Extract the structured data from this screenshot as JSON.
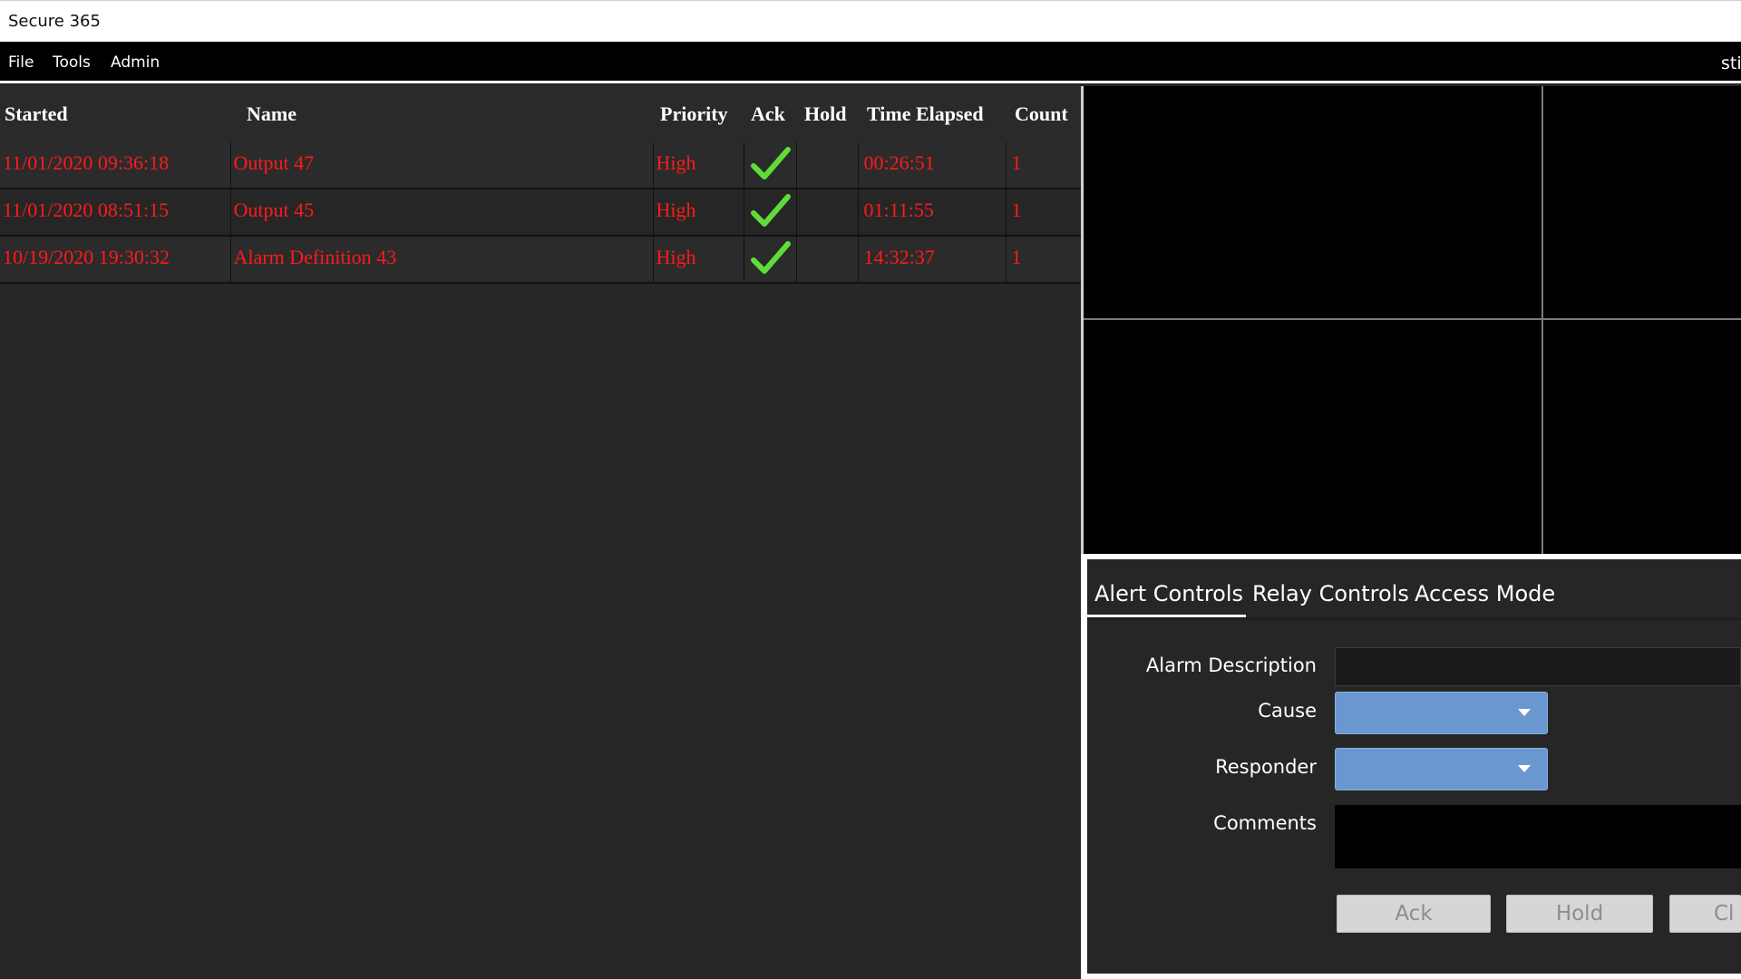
{
  "window": {
    "title": "Secure 365"
  },
  "menu": {
    "items": [
      {
        "label": "File"
      },
      {
        "label": "Tools"
      },
      {
        "label": "Admin"
      }
    ],
    "user_label": "sti"
  },
  "alarms": {
    "columns": [
      "Started",
      "Name",
      "Priority",
      "Ack",
      "Hold",
      "Time Elapsed",
      "Count"
    ],
    "rows": [
      {
        "started": "11/01/2020 09:36:18",
        "name": "Output 47",
        "priority": "High",
        "ack": true,
        "hold": "",
        "elapsed": "00:26:51",
        "count": "1"
      },
      {
        "started": "11/01/2020 08:51:15",
        "name": "Output 45",
        "priority": "High",
        "ack": true,
        "hold": "",
        "elapsed": "01:11:55",
        "count": "1"
      },
      {
        "started": "10/19/2020 19:30:32",
        "name": "Alarm Definition 43",
        "priority": "High",
        "ack": true,
        "hold": "",
        "elapsed": "14:32:37",
        "count": "1"
      }
    ]
  },
  "controls": {
    "tabs": [
      {
        "label": "Alert Controls",
        "active": true
      },
      {
        "label": "Relay Controls",
        "active": false
      },
      {
        "label": "Access Mode",
        "active": false
      }
    ],
    "fields": {
      "description_label": "Alarm Description",
      "description_value": "",
      "cause_label": "Cause",
      "cause_value": "",
      "responder_label": "Responder",
      "responder_value": "",
      "comments_label": "Comments",
      "comments_value": ""
    },
    "buttons": {
      "ack": "Ack",
      "hold": "Hold",
      "clear": "Cl"
    }
  },
  "colors": {
    "alarm_text": "#ff1a1a",
    "ack_check": "#5fdc3a",
    "dropdown": "#6b97d1",
    "button_disabled": "#d6d6d6"
  },
  "icons": {
    "ack": "checkmark-icon",
    "dropdown": "chevron-down-icon"
  }
}
